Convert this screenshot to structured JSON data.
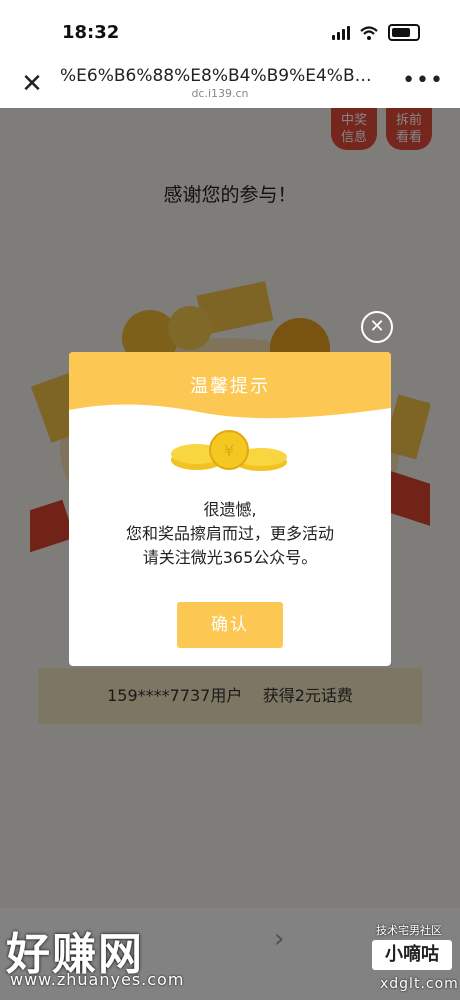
{
  "status_bar": {
    "time": "18:32"
  },
  "nav_bar": {
    "title": "%E6%B6%88%E8%B4%B9%E4%B8%A",
    "domain": "dc.i139.cn",
    "close_icon": "close-icon",
    "more_icon": "more-icon"
  },
  "page": {
    "tabs": [
      {
        "label": "中奖\n信息"
      },
      {
        "label": "拆前\n看看"
      }
    ],
    "thanks": "感谢您的参与！",
    "winner_text": "159****7737用户    获得2元话费"
  },
  "dialog": {
    "title": "温馨提示",
    "message_lines": [
      "很遗憾,",
      "您和奖品擦肩而过，更多活动",
      "请关注微光365公众号。"
    ],
    "confirm_label": "确认"
  },
  "watermark": {
    "left_text": "好赚网",
    "left_url": "www.zhuanyes.com",
    "right_caption": "技术宅男社区",
    "right_logo": "小嘀咕",
    "right_url": "xdglt.com"
  },
  "colors": {
    "accent_yellow": "#fcc853",
    "tab_red": "#e14b3b"
  }
}
